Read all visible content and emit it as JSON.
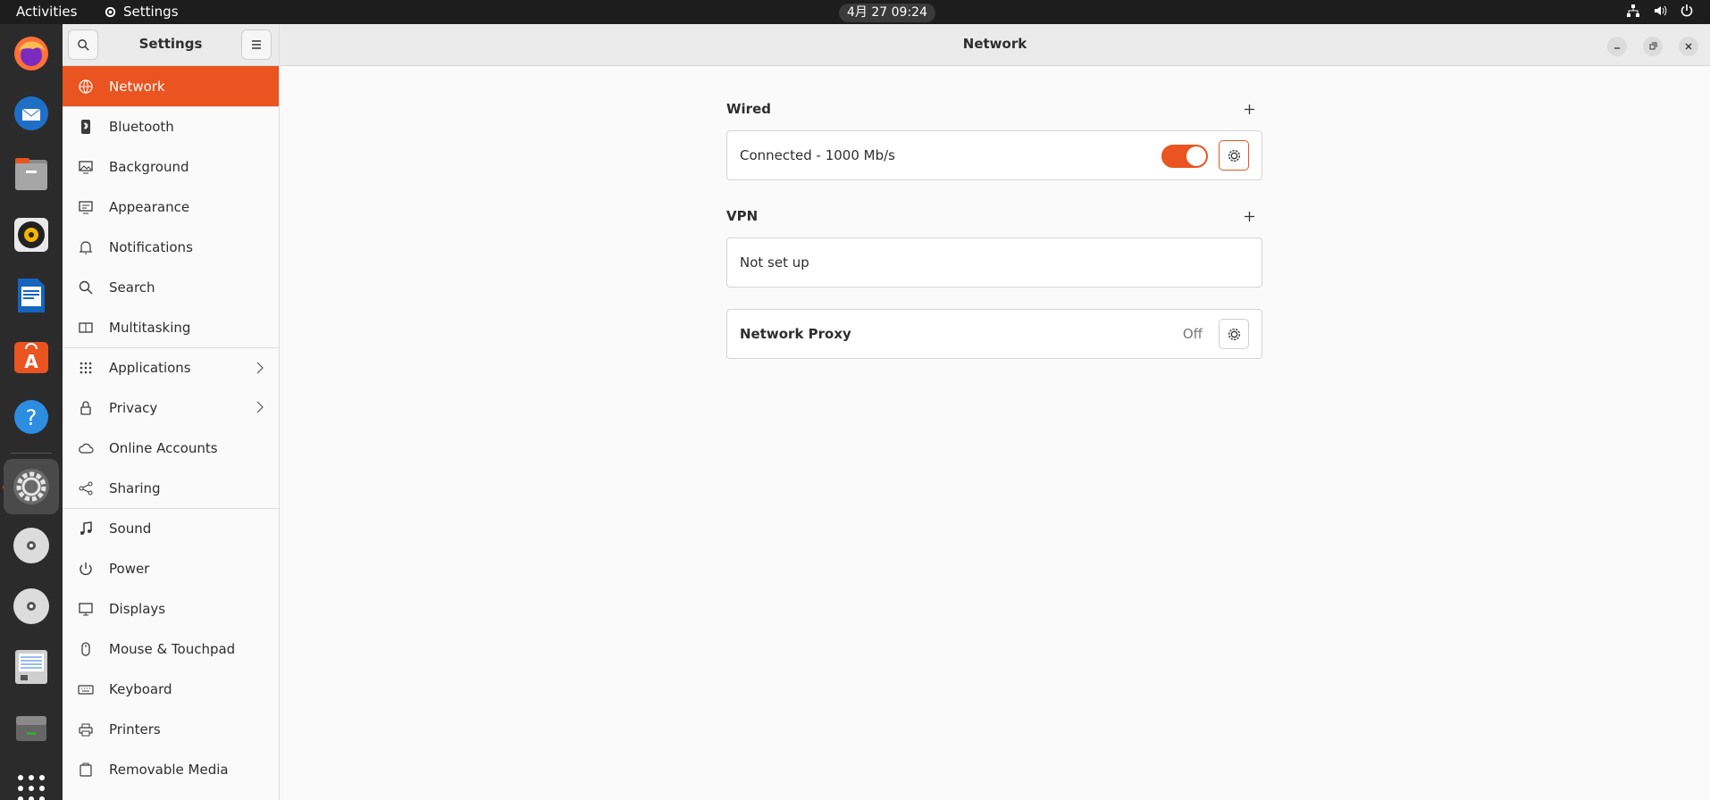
{
  "topbar": {
    "activities": "Activities",
    "app_name": "Settings",
    "clock": "4月 27  09:24"
  },
  "dock": {
    "items": [
      {
        "name": "firefox-icon"
      },
      {
        "name": "thunderbird-icon"
      },
      {
        "name": "files-icon"
      },
      {
        "name": "rhythmbox-icon"
      },
      {
        "name": "libreoffice-writer-icon"
      },
      {
        "name": "app-center-icon"
      },
      {
        "name": "help-icon"
      },
      {
        "name": "settings-icon",
        "active": true
      },
      {
        "name": "disc-icon"
      },
      {
        "name": "disc-icon-2"
      },
      {
        "name": "text-editor-icon"
      },
      {
        "name": "drive-icon"
      },
      {
        "name": "show-apps-icon"
      }
    ]
  },
  "sidebar": {
    "title": "Settings",
    "items": [
      {
        "label": "Network",
        "icon": "network-icon",
        "selected": true
      },
      {
        "label": "Bluetooth",
        "icon": "bluetooth-icon"
      },
      {
        "label": "Background",
        "icon": "background-icon"
      },
      {
        "label": "Appearance",
        "icon": "appearance-icon"
      },
      {
        "label": "Notifications",
        "icon": "bell-icon"
      },
      {
        "label": "Search",
        "icon": "search-icon"
      },
      {
        "label": "Multitasking",
        "icon": "multitasking-icon"
      },
      {
        "label": "Applications",
        "icon": "apps-grid-icon",
        "chevron": true
      },
      {
        "label": "Privacy",
        "icon": "lock-icon",
        "chevron": true
      },
      {
        "label": "Online Accounts",
        "icon": "cloud-icon"
      },
      {
        "label": "Sharing",
        "icon": "share-icon"
      },
      {
        "label": "Sound",
        "icon": "music-note-icon"
      },
      {
        "label": "Power",
        "icon": "power-icon"
      },
      {
        "label": "Displays",
        "icon": "display-icon"
      },
      {
        "label": "Mouse & Touchpad",
        "icon": "mouse-icon"
      },
      {
        "label": "Keyboard",
        "icon": "keyboard-icon"
      },
      {
        "label": "Printers",
        "icon": "printer-icon"
      },
      {
        "label": "Removable Media",
        "icon": "removable-media-icon"
      }
    ]
  },
  "main": {
    "title": "Network",
    "wired": {
      "title": "Wired",
      "status": "Connected - 1000 Mb/s",
      "enabled": true
    },
    "vpn": {
      "title": "VPN",
      "status": "Not set up"
    },
    "proxy": {
      "label": "Network Proxy",
      "state": "Off"
    }
  },
  "colors": {
    "accent": "#e95420",
    "topbar": "#1d1d1d",
    "dock": "#2b2b2b"
  }
}
